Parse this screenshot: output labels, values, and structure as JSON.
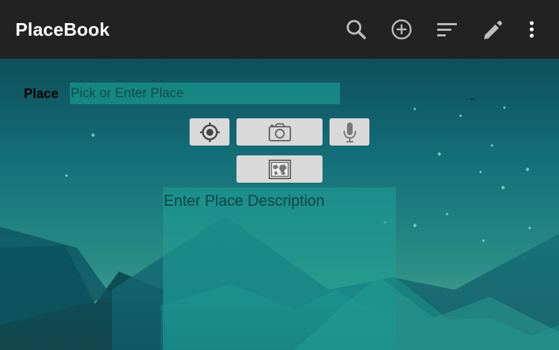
{
  "appbar": {
    "title": "PlaceBook",
    "actions": [
      {
        "icon": "search-icon"
      },
      {
        "icon": "add-circle-icon"
      },
      {
        "icon": "sort-icon"
      },
      {
        "icon": "pencil-icon"
      },
      {
        "icon": "more-vert-icon"
      }
    ],
    "background": "#222222"
  },
  "form": {
    "place_label": "Place",
    "place_placeholder": "Pick or Enter Place",
    "description_placeholder": "Enter Place Description"
  },
  "buttons": [
    {
      "name": "locate",
      "icon": "crosshair-icon"
    },
    {
      "name": "camera",
      "icon": "camera-icon"
    },
    {
      "name": "voice",
      "icon": "microphone-icon"
    },
    {
      "name": "map",
      "icon": "map-icon"
    }
  ],
  "colors": {
    "accent": "#19968c",
    "button_bg": "#d9d9d9",
    "icon_gray": "#555555"
  }
}
